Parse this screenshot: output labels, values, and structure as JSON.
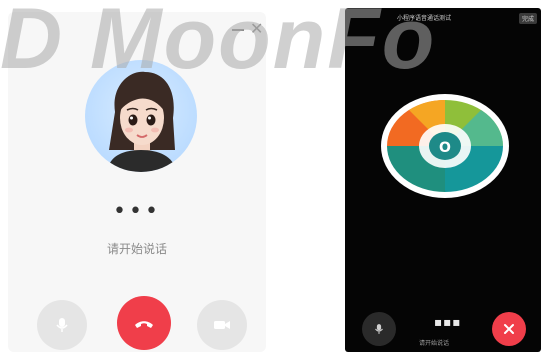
{
  "watermark": "D MoonFo",
  "left": {
    "dots": "•••",
    "status": "请开始说话",
    "icons": {
      "minimize": "minimize-icon",
      "close": "close-icon",
      "mic": "microphone-icon",
      "hangup": "hang-up-icon",
      "video": "video-icon"
    },
    "close_glyph": "✕"
  },
  "phone": {
    "title": "小程序语音通话测试",
    "top_button": "完成",
    "dots": "▪▪▪",
    "status": "请开始说话",
    "logo_text": "O",
    "icons": {
      "mic": "microphone-icon",
      "hangup": "close-icon"
    }
  },
  "colors": {
    "hangup": "#f03e4a",
    "avatar_bg": "#bcdcff",
    "logo_orange": "#f26a22",
    "logo_teal": "#15979a",
    "logo_green": "#8fbf3a"
  }
}
